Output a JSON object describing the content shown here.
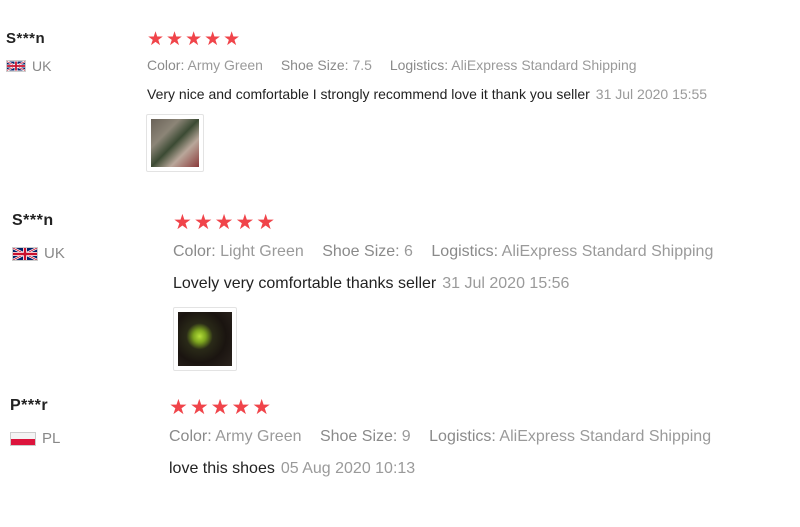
{
  "reviews": [
    {
      "user": "S***n",
      "country": "UK",
      "stars": "★★★★★",
      "color_key": "Color:",
      "color_val": "Army Green",
      "size_key": "Shoe Size:",
      "size_val": "7.5",
      "logistics_key": "Logistics:",
      "logistics_val": "AliExpress Standard Shipping",
      "text": "Very nice and comfortable I strongly recommend love it thank you seller",
      "date": "31 Jul 2020 15:55"
    },
    {
      "user": "S***n",
      "country": "UK",
      "stars": "★★★★★",
      "color_key": "Color:",
      "color_val": "Light Green",
      "size_key": "Shoe Size:",
      "size_val": "6",
      "logistics_key": "Logistics:",
      "logistics_val": "AliExpress Standard Shipping",
      "text": "Lovely very comfortable thanks seller",
      "date": "31 Jul 2020 15:56"
    },
    {
      "user": "P***r",
      "country": "PL",
      "stars": "★★★★★",
      "color_key": "Color:",
      "color_val": "Army Green",
      "size_key": "Shoe Size:",
      "size_val": "9",
      "logistics_key": "Logistics:",
      "logistics_val": "AliExpress Standard Shipping",
      "text": "love this shoes",
      "date": "05 Aug 2020 10:13"
    }
  ],
  "colors": {
    "star": "#f0444a",
    "meta": "#9a9a9a",
    "text": "#222222"
  },
  "icons": {
    "uk_flag": "uk-flag-icon",
    "pl_flag": "pl-flag-icon"
  }
}
